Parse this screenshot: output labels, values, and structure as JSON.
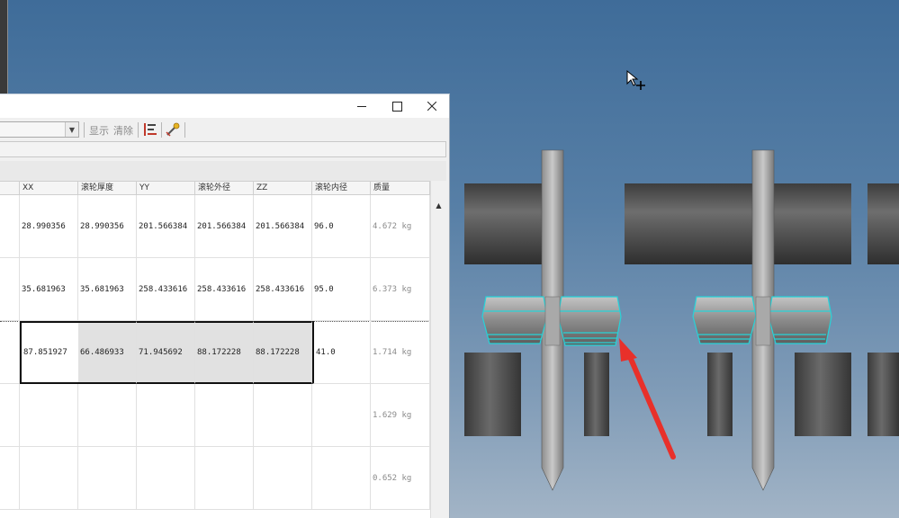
{
  "dialog": {
    "controls": {
      "minimize": "minimize",
      "maximize": "maximize",
      "close": "close"
    },
    "toolbar": {
      "combo_value": "",
      "show_label": "显示",
      "clear_label": "清除",
      "icons": [
        "chart-list-icon",
        "settings-wand-icon"
      ]
    },
    "table": {
      "columns": [
        "XX",
        "滚轮厚度",
        "YY",
        "滚轮外径",
        "ZZ",
        "滚轮内径",
        "质量"
      ],
      "rows": [
        [
          "28.990356",
          "28.990356",
          "201.566384",
          "201.566384",
          "201.566384",
          "96.0",
          "4.672 kg"
        ],
        [
          "35.681963",
          "35.681963",
          "258.433616",
          "258.433616",
          "258.433616",
          "95.0",
          "6.373 kg"
        ],
        [
          "87.851927",
          "66.486933",
          "71.945692",
          "88.172228",
          "88.172228",
          "41.0",
          "1.714 kg"
        ],
        [
          "",
          "",
          "",
          "",
          "",
          "",
          "1.629 kg"
        ],
        [
          "",
          "",
          "",
          "",
          "",
          "",
          "0.652 kg"
        ]
      ]
    }
  },
  "viewport": {
    "background_top": "#3f6c99",
    "highlight_edge_color": "#27d3d8",
    "annotation_color": "#e8302a"
  }
}
